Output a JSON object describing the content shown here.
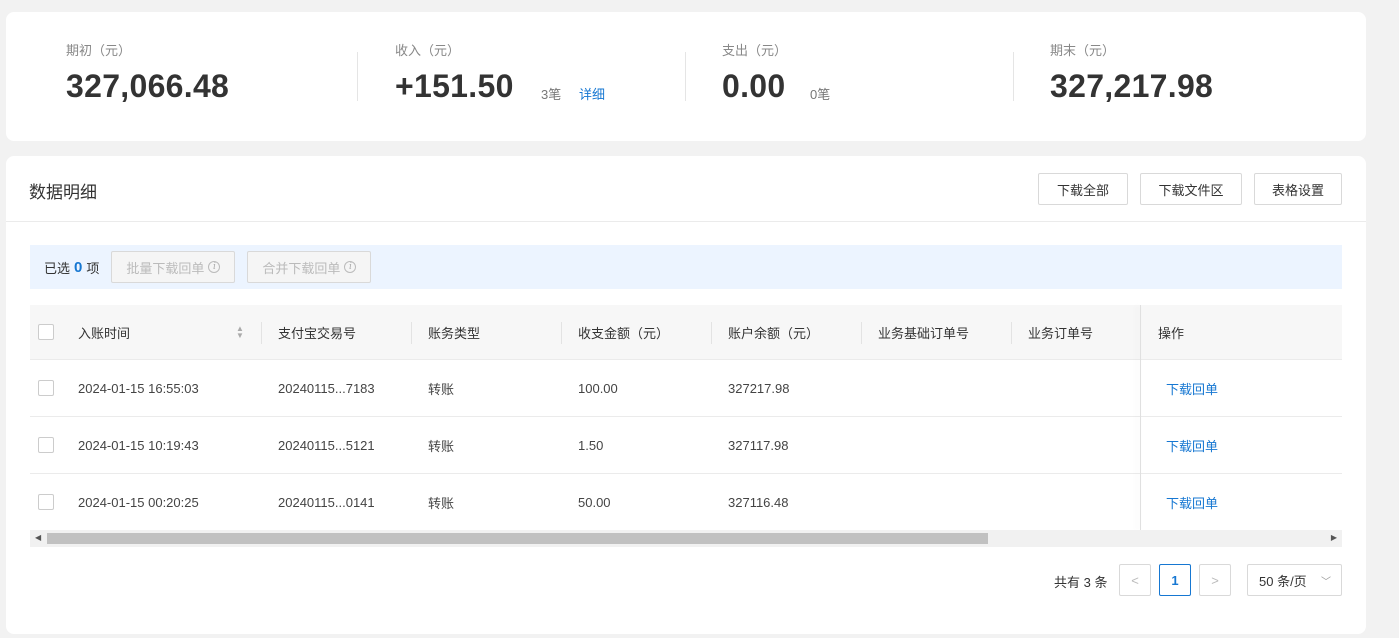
{
  "summary": {
    "opening": {
      "label": "期初（元）",
      "value": "327,066.48"
    },
    "income": {
      "label": "收入（元）",
      "value": "+151.50",
      "count": "3笔",
      "detail": "详细"
    },
    "expense": {
      "label": "支出（元）",
      "value": "0.00",
      "count": "0笔"
    },
    "closing": {
      "label": "期末（元）",
      "value": "327,217.98"
    }
  },
  "detail": {
    "title": "数据明细",
    "buttons": {
      "download_all": "下载全部",
      "download_area": "下载文件区",
      "table_settings": "表格设置"
    }
  },
  "selection": {
    "prefix": "已选",
    "count": "0",
    "suffix": "项",
    "batch_download": "批量下载回单",
    "merge_download": "合并下载回单"
  },
  "table": {
    "columns": [
      "入账时间",
      "支付宝交易号",
      "账务类型",
      "收支金额（元）",
      "账户余额（元）",
      "业务基础订单号",
      "业务订单号",
      "操作"
    ],
    "rows": [
      {
        "time": "2024-01-15 16:55:03",
        "trade_no": "20240115...7183",
        "type": "转账",
        "amount": "100.00",
        "balance": "327217.98",
        "base_order": "",
        "order": "",
        "action": "下载回单"
      },
      {
        "time": "2024-01-15 10:19:43",
        "trade_no": "20240115...5121",
        "type": "转账",
        "amount": "1.50",
        "balance": "327117.98",
        "base_order": "",
        "order": "",
        "action": "下载回单"
      },
      {
        "time": "2024-01-15 00:20:25",
        "trade_no": "20240115...0141",
        "type": "转账",
        "amount": "50.00",
        "balance": "327116.48",
        "base_order": "",
        "order": "",
        "action": "下载回单"
      }
    ]
  },
  "pagination": {
    "total": "共有 3 条",
    "current_page": "1",
    "prev": "<",
    "next": ">",
    "page_size": "50 条/页"
  },
  "icons": {
    "sort": "sort-icon",
    "info": "info-icon",
    "chevron": "chevron-down-icon"
  },
  "colors": {
    "accent": "#1677d2",
    "selbar_bg": "#ecf4ff"
  }
}
